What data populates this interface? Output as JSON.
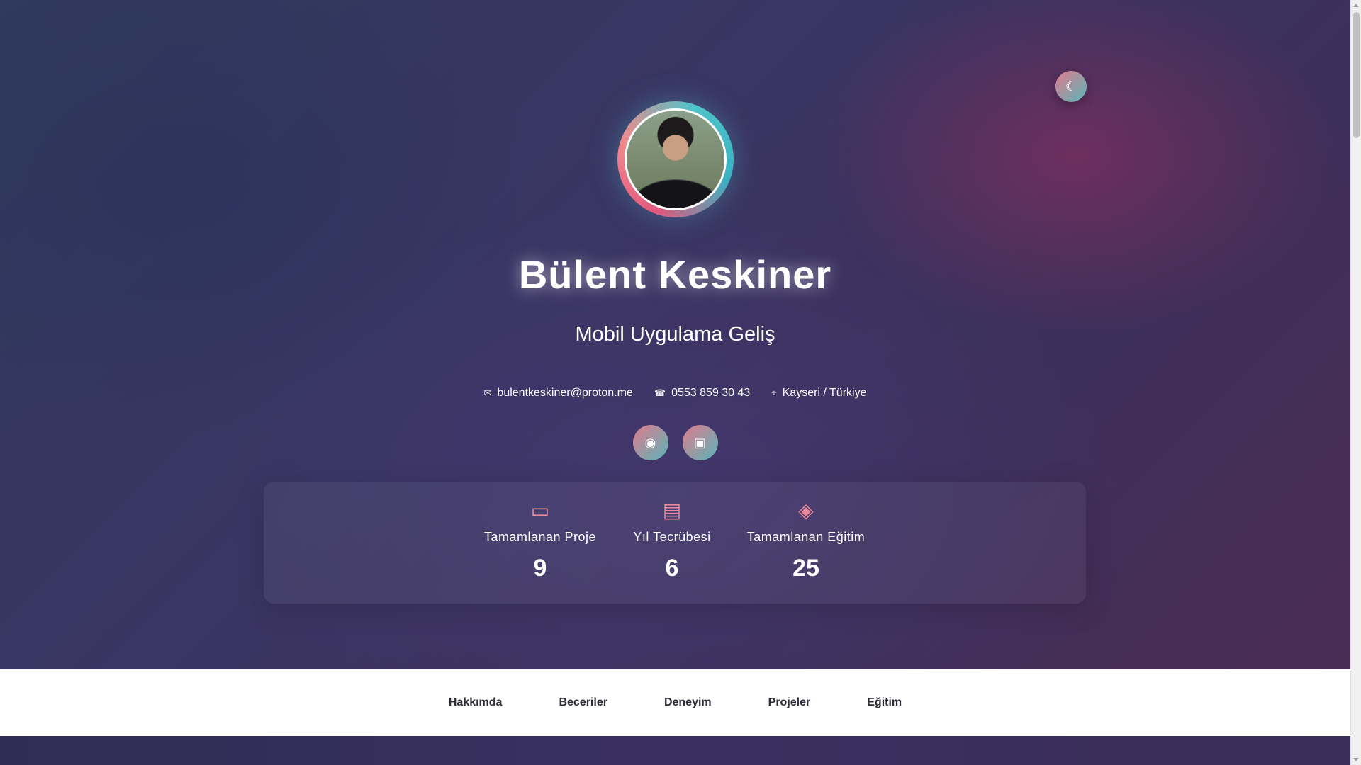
{
  "header": {
    "name": "Bülent Keskiner",
    "subtitle": "Mobil Uygulama Geliş",
    "theme_toggle_icon": "moon-icon"
  },
  "contacts": [
    {
      "icon": "envelope-icon",
      "text": "bulentkeskiner@proton.me"
    },
    {
      "icon": "phone-icon",
      "text": "0553 859 30 43"
    },
    {
      "icon": "location-icon",
      "text": "Kayseri / Türkiye"
    }
  ],
  "socials": [
    {
      "icon": "github-icon"
    },
    {
      "icon": "linkedin-icon"
    }
  ],
  "stats": [
    {
      "icon": "folder-icon",
      "label": "Tamamlanan Proje",
      "value": "9"
    },
    {
      "icon": "briefcase-icon",
      "label": "Yıl Tecrübesi",
      "value": "6"
    },
    {
      "icon": "graduation-cap-icon",
      "label": "Tamamlanan Eğitim",
      "value": "25"
    }
  ],
  "nav": {
    "items": [
      "Hakkımda",
      "Beceriler",
      "Deneyim",
      "Projeler",
      "Eğitim"
    ]
  },
  "colors": {
    "accent_pink": "#e07a8c",
    "accent_teal": "#5ab5b8",
    "nav_background": "#ffffff",
    "nav_text": "#2d2d3a"
  }
}
